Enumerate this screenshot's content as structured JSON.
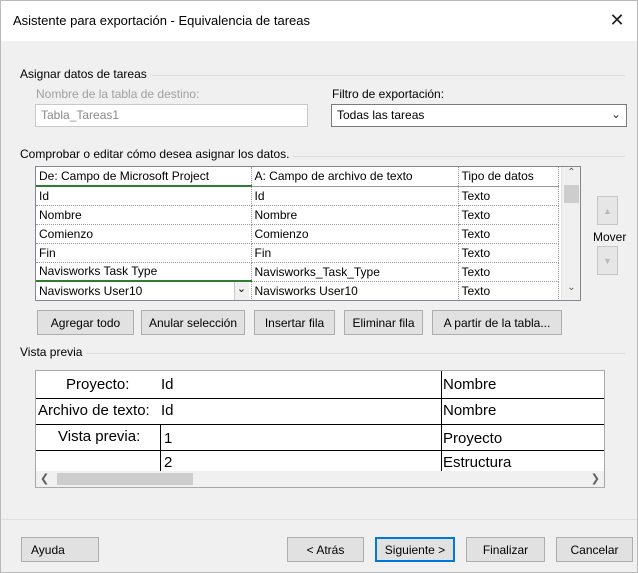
{
  "window": {
    "title": "Asistente para exportación - Equivalencia de tareas",
    "close_glyph": "✕"
  },
  "assign": {
    "group_title": "Asignar datos de tareas",
    "dest_label": "Nombre de la tabla de destino:",
    "dest_value": "Tabla_Tareas1",
    "filter_label": "Filtro de exportación:",
    "filter_value": "Todas las tareas"
  },
  "mapping": {
    "instructions": "Comprobar o editar cómo desea asignar los datos.",
    "headers": [
      "De: Campo de Microsoft Project",
      "A:  Campo de archivo de texto",
      "Tipo de datos"
    ],
    "rows": [
      [
        "Id",
        "Id",
        "Texto"
      ],
      [
        "Nombre",
        "Nombre",
        "Texto"
      ],
      [
        "Comienzo",
        "Comienzo",
        "Texto"
      ],
      [
        "Fin",
        "Fin",
        "Texto"
      ],
      [
        "Navisworks Task Type",
        "Navisworks_Task_Type",
        "Texto"
      ],
      [
        "Navisworks User10",
        "Navisworks User10",
        "Texto"
      ]
    ],
    "move_label": "Mover"
  },
  "buttons": {
    "add_all": "Agregar todo",
    "clear_selection": "Anular selección",
    "insert_row": "Insertar fila",
    "delete_row": "Eliminar fila",
    "from_table": "A partir de la tabla..."
  },
  "preview": {
    "group_title": "Vista previa",
    "rows": [
      {
        "label": "Proyecto:",
        "c1": "Id",
        "c2": "Nombre"
      },
      {
        "label": "Archivo de texto:",
        "c1": "Id",
        "c2": "Nombre"
      },
      {
        "label": "Vista previa:",
        "c1": "1",
        "c2": "Proyecto"
      },
      {
        "label": "",
        "c1": "2",
        "c2": "Estructura"
      }
    ]
  },
  "footer": {
    "help": "Ayuda",
    "back": "< Atrás",
    "next": "Siguiente >",
    "finish": "Finalizar",
    "cancel": "Cancelar"
  }
}
